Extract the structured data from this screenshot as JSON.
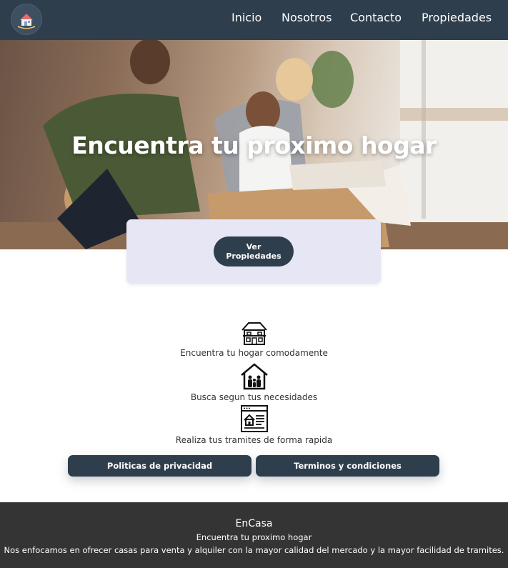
{
  "nav": {
    "links": [
      "Inicio",
      "Nosotros",
      "Contacto",
      "Propiedades"
    ]
  },
  "hero": {
    "title": "Encuentra tu proximo hogar",
    "button_label": "Ver Propiedades"
  },
  "features": [
    {
      "icon": "house-icon",
      "text": "Encuentra tu hogar comodamente"
    },
    {
      "icon": "family-home-icon",
      "text": "Busca segun tus necesidades"
    },
    {
      "icon": "web-listing-icon",
      "text": "Realiza tus tramites de forma rapida"
    }
  ],
  "policies": {
    "privacy_label": "Politicas de privacidad",
    "terms_label": "Terminos y condiciones"
  },
  "footer": {
    "brand": "EnCasa",
    "tagline": "Encuentra tu proximo hogar",
    "description": "Nos enfocamos en ofrecer casas para venta y alquiler con la mayor calidad del mercado y la mayor facilidad de tramites."
  },
  "colors": {
    "nav_bg": "#2f3e4c",
    "button_bg": "#2f3e4c",
    "card_bg": "#e6e6f4",
    "footer_bg": "#343434"
  }
}
